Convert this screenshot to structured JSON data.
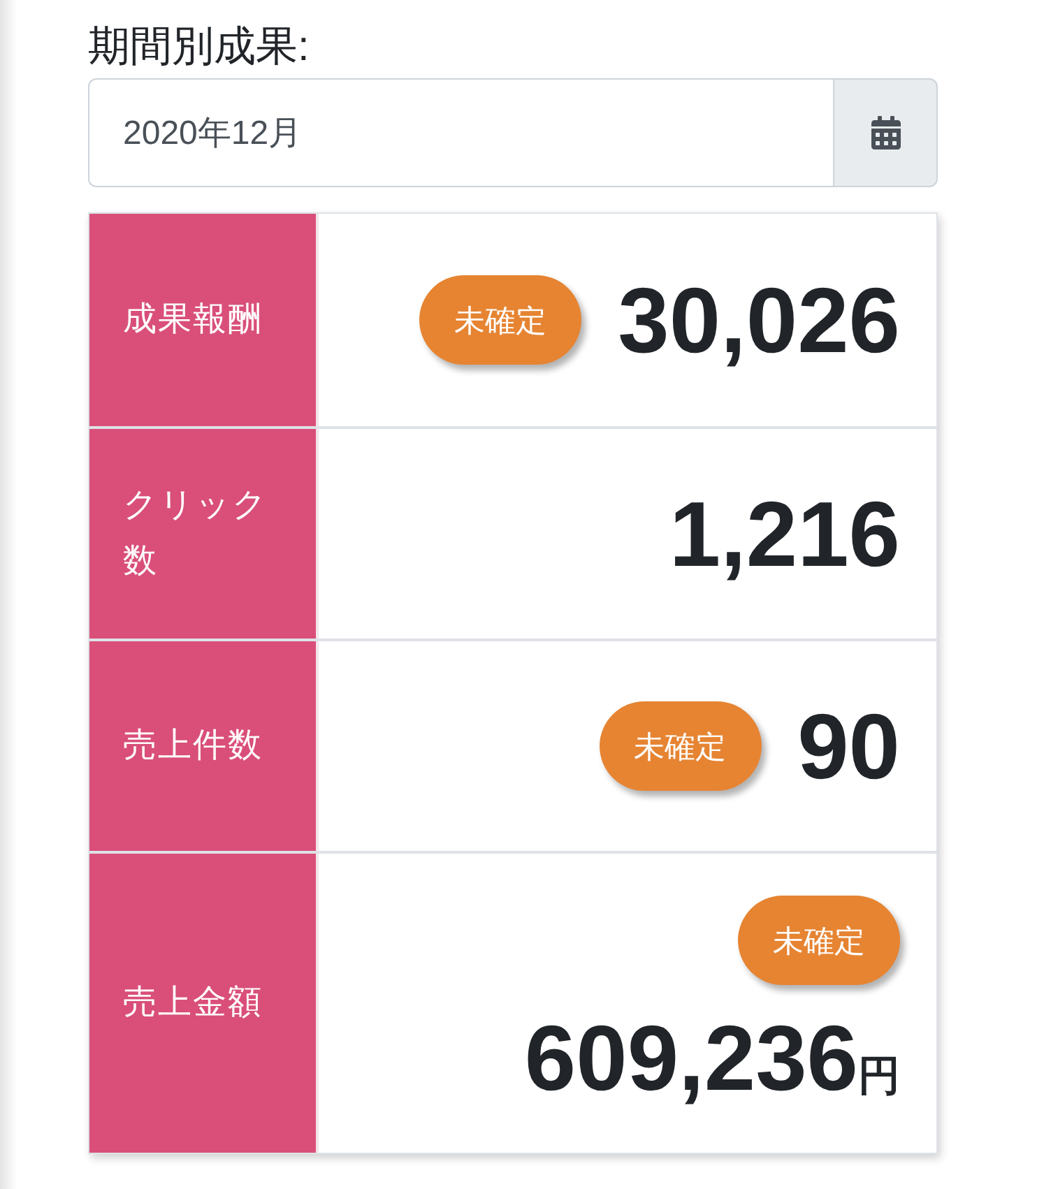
{
  "filter": {
    "label": "期間別成果:",
    "value": "2020年12月"
  },
  "metrics": [
    {
      "label": "成果報酬",
      "badge": "未確定",
      "value": "30,026"
    },
    {
      "label": "クリック数",
      "value": "1,216"
    },
    {
      "label": "売上件数",
      "badge": "未確定",
      "value": "90"
    },
    {
      "label": "売上金額",
      "badge": "未確定",
      "value": "609,236",
      "unit": "円"
    }
  ]
}
